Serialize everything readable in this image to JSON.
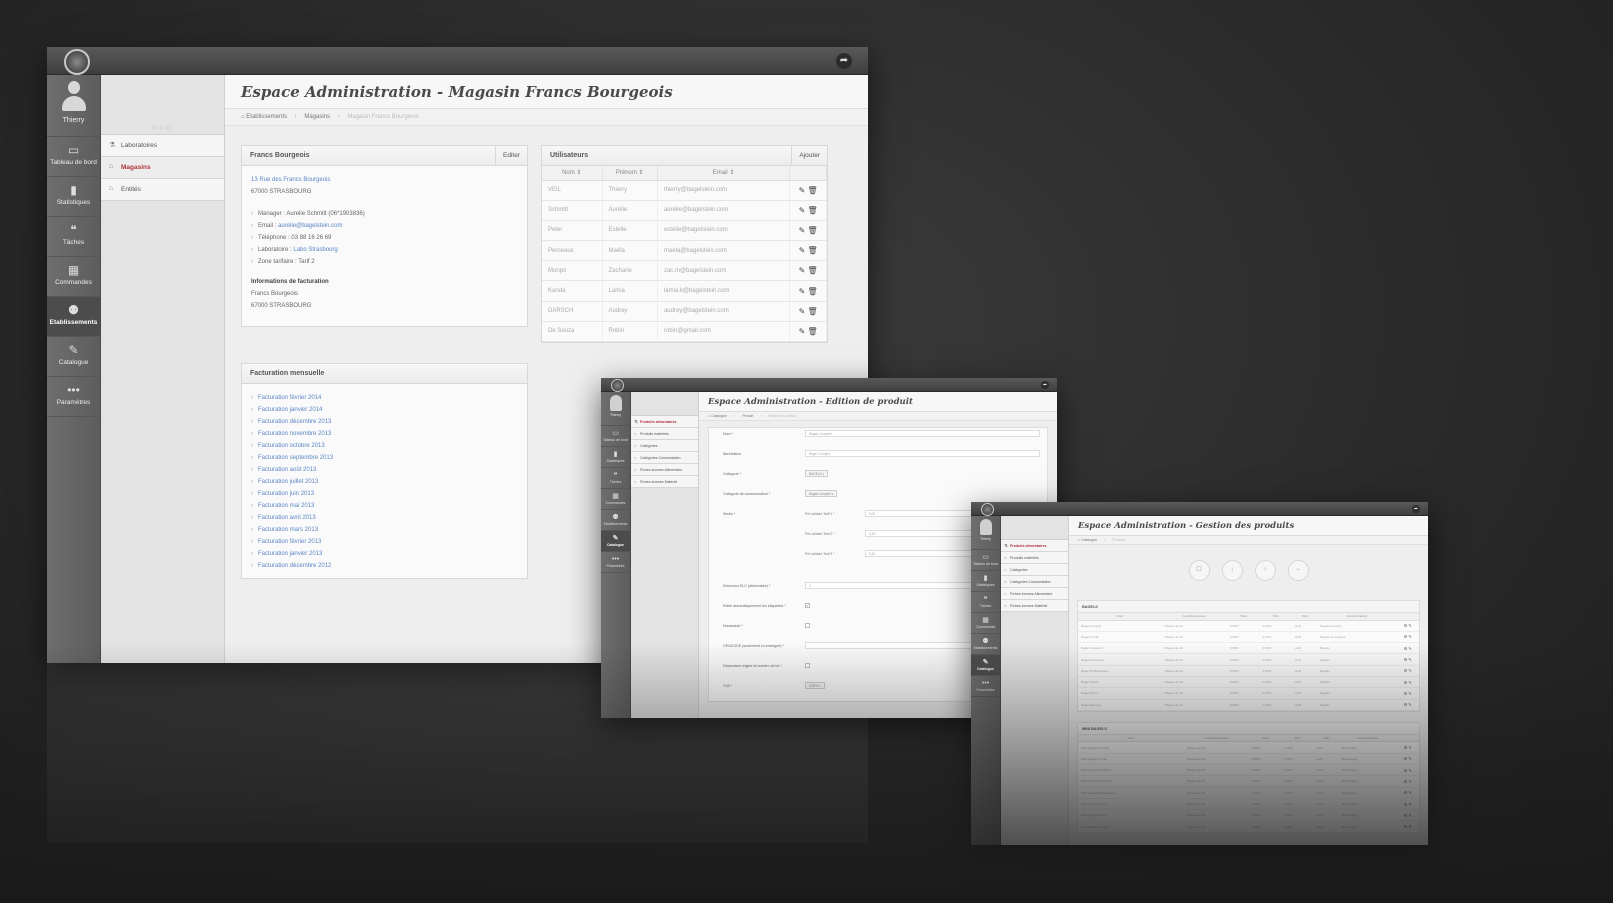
{
  "user": {
    "name": "Thierry"
  },
  "nav": [
    {
      "label": "Tableau de bord",
      "icon": "monitor-icon",
      "glyph": "▭"
    },
    {
      "label": "Statistiques",
      "icon": "bar-chart-icon",
      "glyph": "▮"
    },
    {
      "label": "Tâches",
      "icon": "chat-bubbles-icon",
      "glyph": "❝"
    },
    {
      "label": "Commandes",
      "icon": "orders-icon",
      "glyph": "▦"
    },
    {
      "label": "Etablissements",
      "icon": "group-icon",
      "glyph": "⚉"
    },
    {
      "label": "Catalogue",
      "icon": "edit-icon",
      "glyph": "✎"
    },
    {
      "label": "Paramètres",
      "icon": "ellipsis-icon",
      "glyph": "•••"
    }
  ],
  "main": {
    "title": "Espace Administration - Magasin Francs Bourgeois",
    "breadcrumbs": [
      "Etablissements",
      "Magasins",
      "Magasin Francs Bourgeois"
    ],
    "subnav": [
      "Laboratoires",
      "Magasins",
      "Entités"
    ],
    "store_panel": {
      "title": "Francs Bourgeois",
      "edit_label": "Editer",
      "address_line1": "13 Rue des Francs Bourgeois",
      "address_line2": "67000 STRASBOURG",
      "manager_label": "Manager : ",
      "manager_value": "Aurelie Schmitt (06*1903836)",
      "email_label": "Email : ",
      "email_value": "aurelie@bagelstein.com",
      "phone_label": "Téléphone : ",
      "phone_value": "03 88 16 26 69",
      "lab_label": "Laboratoire : ",
      "lab_value": "Labo Strasbourg",
      "zone_label": "Zone tarifaire : ",
      "zone_value": "Tarif 2",
      "billing_title": "Informations de facturation",
      "billing_line1": "Francs Bourgeois",
      "billing_line2": "67000 STRASBOURG"
    },
    "users_panel": {
      "title": "Utilisateurs",
      "add_label": "Ajouter",
      "columns": [
        "Nom",
        "Prénom",
        "Email"
      ],
      "rows": [
        [
          "VEIL",
          "Thierry",
          "thierry@bagelstein.com"
        ],
        [
          "Schmitt",
          "Aurélie",
          "aurelie@bagelstein.com"
        ],
        [
          "Peter",
          "Estelle",
          "estelle@bagelstein.com"
        ],
        [
          "Perrieaux",
          "Maëla",
          "maela@bagelstein.com"
        ],
        [
          "Monpo",
          "Zacharie",
          "zac.m@bagelstein.com"
        ],
        [
          "Kanda",
          "Lamia",
          "lamia.k@bagelstein.com"
        ],
        [
          "DARSCH",
          "Audrey",
          "audrey@bagelstein.com"
        ],
        [
          "De Souza",
          "Robin",
          "robin@gmail.com"
        ]
      ]
    },
    "billing_panel": {
      "title": "Facturation mensuelle",
      "items": [
        "Facturation février 2014",
        "Facturation janvier 2014",
        "Facturation décembre 2013",
        "Facturation novembre 2013",
        "Facturation octobre 2013",
        "Facturation septembre 2013",
        "Facturation août 2013",
        "Facturation juillet 2013",
        "Facturation juin 2013",
        "Facturation mai 2013",
        "Facturation avril 2013",
        "Facturation mars 2013",
        "Facturation février 2013",
        "Facturation janvier 2013",
        "Facturation décembre 2012"
      ]
    }
  },
  "edit_screen": {
    "title": "Espace Administration - Edition de produit",
    "breadcrumbs": [
      "Catalogue",
      "Produit",
      "Edition de produit"
    ],
    "subnav": [
      "Produits alimentaires",
      "Produits matériels",
      "Catégories",
      "Catégories Consomtation",
      "Fiches-bonnes Alimentaire",
      "Fiches-bonnes Matériel"
    ],
    "fields": [
      {
        "label": "Nom *",
        "value": "Bagels Complet"
      },
      {
        "label": "Abréviation",
        "value": "Bagel Complet"
      },
      {
        "label": "Catégorie *",
        "value": "BAGELS"
      },
      {
        "label": "Catégorie de consommation *",
        "value": "Bagels complet"
      },
      {
        "label": "Seuils *",
        "value": ""
      },
      {
        "label": "Extension DLC (alimentaire) *",
        "value": "0"
      },
      {
        "label": "Editer automatiquement les étiquettes *",
        "value": "✓"
      },
      {
        "label": "Nouveauté *",
        "value": ""
      },
      {
        "label": "GENCODE (seulement si renseigné) *",
        "value": ""
      },
      {
        "label": "Dépendant origine et numéro de lot *",
        "value": ""
      },
      {
        "label": "TVA *",
        "value": "5,50%"
      }
    ],
    "price_labels": [
      "Prix unitaire Tarif 1 *",
      "Prix unitaire Tarif 2 *",
      "Prix unitaire Tarif 3 *"
    ],
    "price_values": [
      "5,00",
      "5,25",
      "5,40"
    ]
  },
  "products_screen": {
    "title": "Espace Administration - Gestion des produits",
    "breadcrumbs": [
      "Catalogue",
      "Produits"
    ],
    "subnav": [
      "Produits alimentaires",
      "Produits matériels",
      "Catégories",
      "Catégories Consomtation",
      "Fiches-bonnes Alimentaire",
      "Fiches-bonnes Matériel"
    ],
    "action_glyphs": [
      "☐",
      "↓",
      "↑",
      "−"
    ],
    "columns": [
      "Nom",
      "Conditionnement",
      "Total",
      "Prix",
      "Stat",
      "Consommation"
    ],
    "sections": [
      {
        "name": "BAGELS",
        "rows": [
          [
            "Bagel Complet",
            "Plaque de 10",
            "5,50%",
            "0,50 €",
            "Actif",
            "Bagels complet"
          ],
          [
            "Bagel à l'Aile",
            "Plaque de 10",
            "5,50%",
            "0,50 €",
            "Actif",
            "Bagels au sésame"
          ],
          [
            "Bagel Cranberry",
            "Plaque de 10",
            "5,50%",
            "0,50 €",
            "Actif",
            "Bagels"
          ],
          [
            "Bagel Emmental",
            "Plaque de 10",
            "5,50%",
            "0,50 €",
            "Actif",
            "Bagels"
          ],
          [
            "Bagel Multicéréales",
            "Plaque de 10",
            "5,50%",
            "0,50 €",
            "Actif",
            "Bagels"
          ],
          [
            "Bagel Nature",
            "Plaque de 10",
            "5,50%",
            "0,50 €",
            "Actif",
            "Bagels"
          ],
          [
            "Bagel Pavot",
            "Plaque de 10",
            "5,50%",
            "0,50 €",
            "Actif",
            "Bagels"
          ],
          [
            "Bagel Sésame",
            "Plaque de 10",
            "5,50%",
            "0,50 €",
            "Actif",
            "Bagels"
          ]
        ]
      },
      {
        "name": "MINI BAGELS",
        "rows": [
          [
            "Mini Bagels Complet",
            "Plaque de 20",
            "5,50%",
            "0,30 €",
            "Actif",
            "Mini bagels"
          ],
          [
            "Mini Bagels à l'Aile",
            "Plaque de 20",
            "5,50%",
            "0,30 €",
            "Actif",
            "Mini bagels"
          ],
          [
            "Mini Bagels Cranberry",
            "Plaque de 20",
            "5,50%",
            "0,30 €",
            "Actif",
            "Mini bagels"
          ],
          [
            "Mini Bagels Emmental",
            "Plaque de 20",
            "5,50%",
            "0,30 €",
            "Actif",
            "Mini bagels"
          ],
          [
            "Mini Bagels Multicéréales",
            "Plaque de 20",
            "5,50%",
            "0,30 €",
            "Actif",
            "Mini bagels"
          ],
          [
            "Mini Bagels Nature",
            "Plaque de 20",
            "5,50%",
            "0,30 €",
            "Actif",
            "Mini bagels"
          ],
          [
            "Mini Bagels Pavot",
            "Plaque de 20",
            "5,50%",
            "0,30 €",
            "Actif",
            "Mini bagels"
          ],
          [
            "Mini Bagels Sésame",
            "Plaque de 20",
            "5,50%",
            "0,30 €",
            "Actif",
            "Mini bagels"
          ]
        ]
      }
    ]
  },
  "colors": {
    "accent": "#b0323a",
    "link": "#5b86c4",
    "sidebar": "#636363"
  }
}
